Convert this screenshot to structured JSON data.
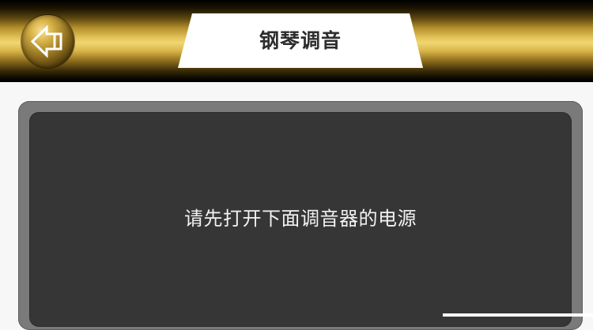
{
  "header": {
    "title": "钢琴调音",
    "back_icon": "back-arrow-icon"
  },
  "panel": {
    "message": "请先打开下面调音器的电源"
  },
  "colors": {
    "header_gold": "#e3c35a",
    "panel_outer": "#7a7a7a",
    "panel_inner": "#363636",
    "title_tab_bg": "#ffffff",
    "page_bg": "#f7f7f7"
  }
}
